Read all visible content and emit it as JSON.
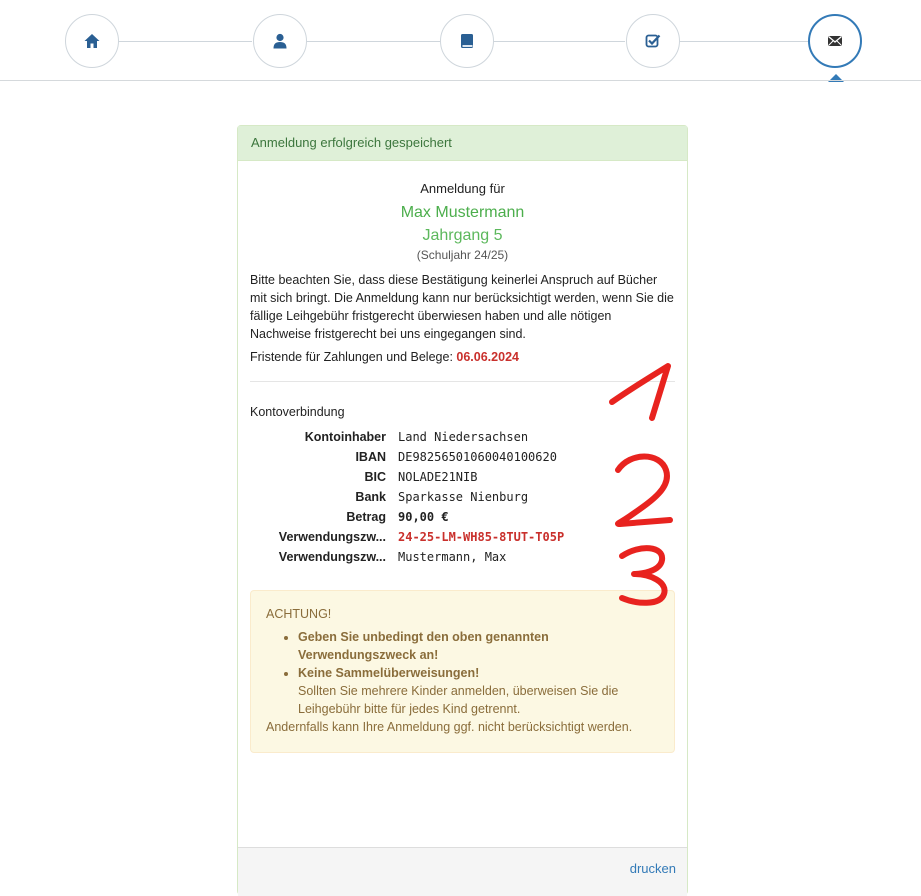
{
  "wizard": {
    "steps": [
      {
        "icon": "home-icon",
        "state": "done"
      },
      {
        "icon": "user-icon",
        "state": "done"
      },
      {
        "icon": "book-icon",
        "state": "done"
      },
      {
        "icon": "checkbox-icon",
        "state": "done"
      },
      {
        "icon": "envelope-icon",
        "state": "active"
      }
    ],
    "accent_color": "#337ab7"
  },
  "panel": {
    "heading": "Anmeldung erfolgreich gespeichert",
    "registration_for": "Anmeldung für",
    "student_name": "Max Mustermann",
    "grade": "Jahrgang 5",
    "school_year": "(Schuljahr 24/25)",
    "notice": "Bitte beachten Sie, dass diese Bestätigung keinerlei Anspruch auf Bücher mit sich bringt. Die Anmeldung kann nur berücksichtigt werden, wenn Sie die fällige Leihgebühr fristgerecht überwiesen haben und alle nötigen Nachweise fristgerecht bei uns eingegangen sind.",
    "deadline_label": "Fristende für Zahlungen und Belege:",
    "deadline_date": "06.06.2024",
    "account_title": "Kontoverbindung",
    "account": [
      {
        "label": "Kontoinhaber",
        "value": "Land Niedersachsen"
      },
      {
        "label": "IBAN",
        "value": "DE98256501060040100620"
      },
      {
        "label": "BIC",
        "value": "NOLADE21NIB"
      },
      {
        "label": "Bank",
        "value": "Sparkasse Nienburg"
      },
      {
        "label": "Betrag",
        "value": "90,00 €"
      },
      {
        "label": "Verwendungszw...",
        "value": "24-25-LM-WH85-8TUT-T05P"
      },
      {
        "label": "Verwendungszw...",
        "value": "Mustermann, Max"
      }
    ],
    "warning": {
      "title": "ACHTUNG!",
      "item1_bold": "Geben Sie unbedingt den oben genannten Verwendungszweck an!",
      "item2_bold": "Keine Sammelüberweisungen!",
      "item2_text": "Sollten Sie mehrere Kinder anmelden, überweisen Sie die Leihgebühr bitte für jedes Kind getrennt.",
      "footer": "Andernfalls kann Ihre Anmeldung ggf. nicht berücksichtigt werden."
    },
    "print_label": "drucken"
  },
  "annotations": {
    "marks": [
      "1",
      "2",
      "3"
    ],
    "color": "#e8231f"
  },
  "colors": {
    "success_bg": "#dff0d8",
    "success_text": "#3c763d",
    "name_green": "#4cae4c",
    "deadline_red": "#c9302c",
    "warning_bg": "#fcf8e3",
    "warning_text": "#8a6d3b",
    "link_blue": "#337ab7"
  }
}
